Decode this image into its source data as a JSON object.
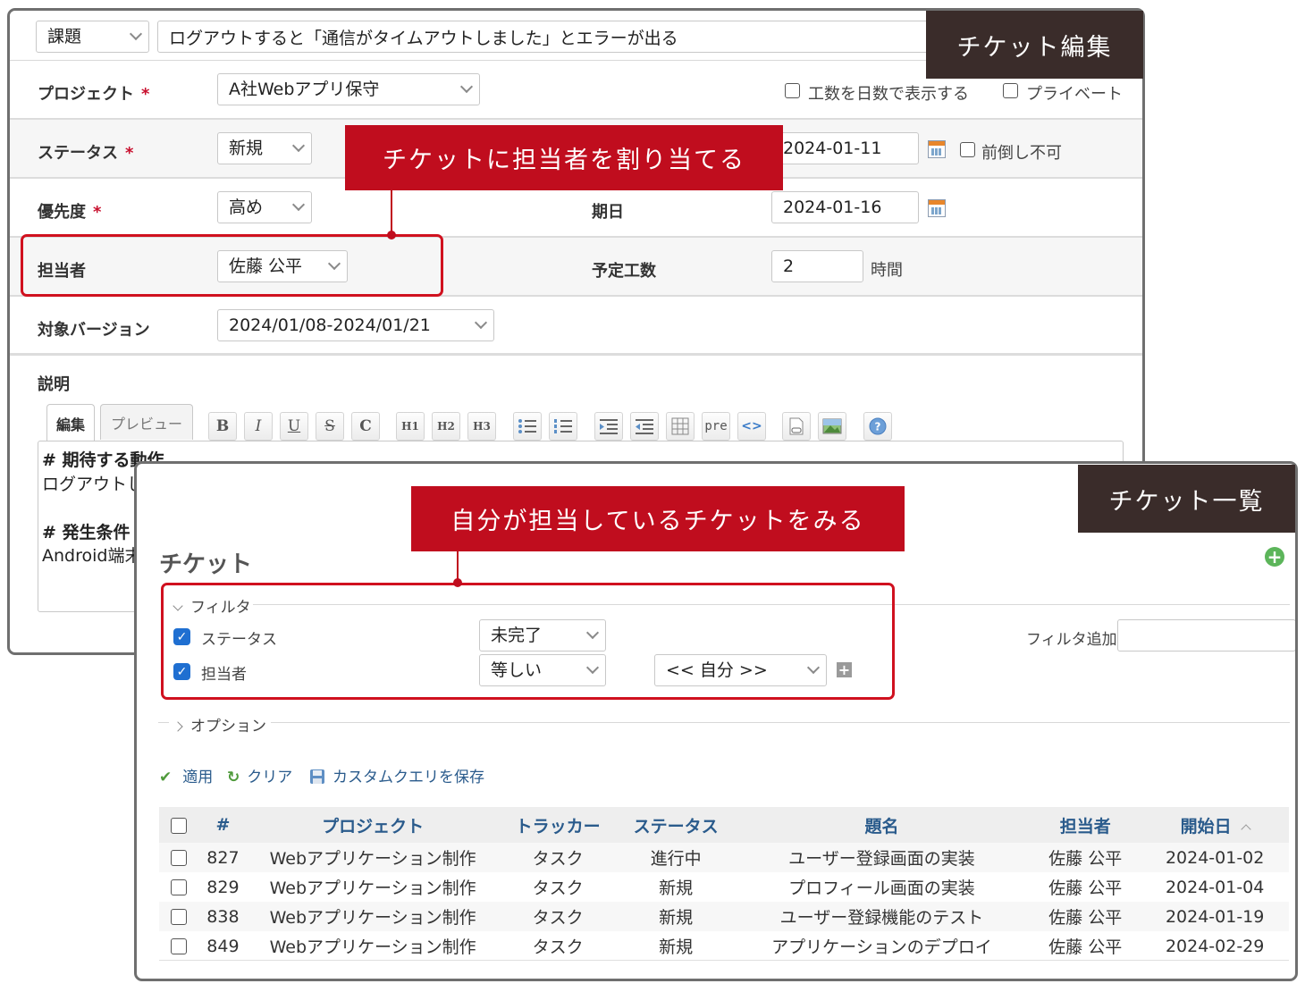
{
  "edit": {
    "section_label": "チケット編集",
    "tracker_value": "課題",
    "subject_value": "ログアウトすると「通信がタイムアウトしました」とエラーが出る",
    "project_label": "プロジェクト",
    "project_value": "A社Webアプリ保守",
    "required_mark": "*",
    "workdays_label": "工数を日数で表示する",
    "private_label": "プライベート",
    "status_label": "ステータス",
    "status_value": "新規",
    "start_date_value": "2024-01-11",
    "no_earlier_label": "前倒し不可",
    "priority_label": "優先度",
    "priority_value": "高め",
    "due_label": "期日",
    "due_value": "2024-01-16",
    "assignee_label": "担当者",
    "assignee_value": "佐藤 公平",
    "estimate_label": "予定工数",
    "estimate_value": "2",
    "estimate_unit": "時間",
    "version_label": "対象バージョン",
    "version_value": "2024/01/08-2024/01/21",
    "description_label": "説明",
    "tab_edit": "編集",
    "tab_preview": "プレビュー",
    "toolbar": {
      "bold": "B",
      "italic": "I",
      "underline": "U",
      "strike": "S",
      "code": "C",
      "h1": "H1",
      "h2": "H2",
      "h3": "H3",
      "pre": "pre",
      "inline_code": "<>"
    },
    "description_lines": [
      "# 期待する動作",
      "ログアウトし",
      "",
      "# 発生条件",
      "Android端末"
    ],
    "callout": "チケットに担当者を割り当てる"
  },
  "list": {
    "section_label": "チケット一覧",
    "title": "チケット",
    "callout": "自分が担当しているチケットをみる",
    "filters_legend": "フィルタ",
    "filter_status_label": "ステータス",
    "filter_status_op": "未完了",
    "filter_assignee_label": "担当者",
    "filter_assignee_op": "等しい",
    "filter_assignee_value": "<< 自分 >>",
    "add_filter_label": "フィルタ追加",
    "options_legend": "オプション",
    "apply_label": "適用",
    "clear_label": "クリア",
    "save_query_label": "カスタムクエリを保存",
    "columns": [
      "#",
      "プロジェクト",
      "トラッカー",
      "ステータス",
      "題名",
      "担当者",
      "開始日"
    ],
    "rows": [
      {
        "id": "827",
        "project": "Webアプリケーション制作",
        "tracker": "タスク",
        "status": "進行中",
        "subject": "ユーザー登録画面の実装",
        "assignee": "佐藤 公平",
        "start": "2024-01-02"
      },
      {
        "id": "829",
        "project": "Webアプリケーション制作",
        "tracker": "タスク",
        "status": "新規",
        "subject": "プロフィール画面の実装",
        "assignee": "佐藤 公平",
        "start": "2024-01-04"
      },
      {
        "id": "838",
        "project": "Webアプリケーション制作",
        "tracker": "タスク",
        "status": "新規",
        "subject": "ユーザー登録機能のテスト",
        "assignee": "佐藤 公平",
        "start": "2024-01-19"
      },
      {
        "id": "849",
        "project": "Webアプリケーション制作",
        "tracker": "タスク",
        "status": "新規",
        "subject": "アプリケーションのデプロイ",
        "assignee": "佐藤 公平",
        "start": "2024-02-29"
      }
    ]
  },
  "colors": {
    "accent_red": "#c00d1e",
    "label_dark": "#3a2c2a",
    "link_blue": "#2a5b8c",
    "check_blue": "#1f6fd1"
  }
}
